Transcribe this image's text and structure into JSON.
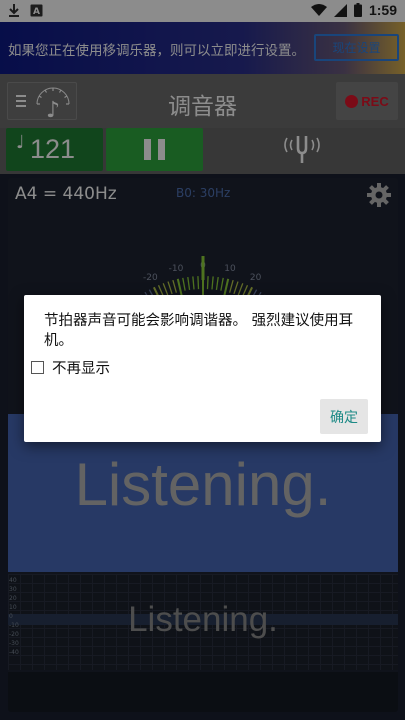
{
  "status_bar": {
    "time": "1:59",
    "icons": [
      "download-icon",
      "app-a-icon",
      "wifi-icon",
      "signal-icon",
      "battery-icon"
    ]
  },
  "banner": {
    "text": "如果您正在使用移调乐器，则可以立即进行设置。",
    "button_label": "现在设置"
  },
  "toolbar": {
    "title": "调音器",
    "rec_label": "REC"
  },
  "controls": {
    "bpm_value": "121",
    "pause_icon": "pause-icon",
    "fork_icon": "tuning-fork-icon"
  },
  "tuner": {
    "a4_label": "A4 = 440Hz",
    "b0_label": "B0: 30Hz",
    "gauge_ticks": [
      "-20",
      "-10",
      "0",
      "10",
      "20"
    ],
    "listening_big": "Listening.",
    "listening_small": "Listening.",
    "graph_labels": [
      "40",
      "30",
      "20",
      "10",
      "0",
      "-10",
      "-20",
      "-30",
      "-40"
    ]
  },
  "dialog": {
    "message": "节拍器声音可能会影响调谐器。 强烈建议使用耳机。",
    "checkbox_label": "不再显示",
    "checkbox_checked": false,
    "ok_label": "确定"
  },
  "colors": {
    "bpm_green": "#1f7e33",
    "pause_green": "#2ea83e",
    "rec_red": "#e0152a",
    "listening_band": "#4868b8",
    "ok_text": "#1d8a86"
  }
}
